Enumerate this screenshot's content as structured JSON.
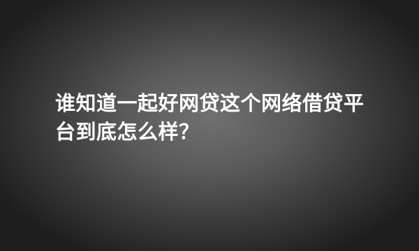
{
  "question": {
    "title": "谁知道一起好网贷这个网络借贷平台到底怎么样？"
  },
  "colors": {
    "background_center": "#707070",
    "background_edge": "#1e1e1e",
    "text": "#ffffff"
  }
}
